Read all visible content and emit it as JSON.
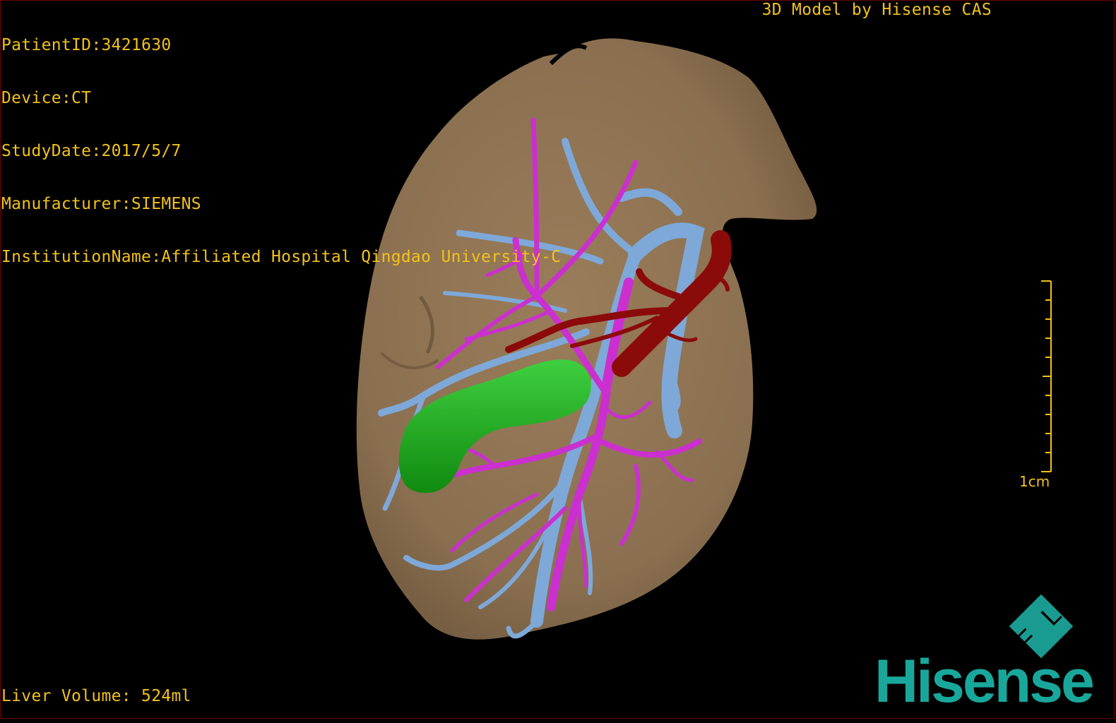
{
  "overlay": {
    "patient_id": "PatientID:3421630",
    "device": "Device:CT",
    "study_date": "StudyDate:2017/5/7",
    "manufacturer": "Manufacturer:SIEMENS",
    "institution": "InstitutionName:Affiliated Hospital Qingdao University-C",
    "model_credit": "3D Model by Hisense CAS",
    "liver_volume": "Liver Volume: 524ml",
    "scale_label": "1cm"
  },
  "logo": {
    "word": "Hisense",
    "mark": "F L"
  },
  "colors": {
    "background": "#000000",
    "text": "#f2c21a",
    "liver": "#8c7252",
    "portal_vein": "#7ea8d8",
    "bile_duct": "#cc2fd0",
    "hepatic_artery": "#8b0a0a",
    "gallbladder": "#1e9e1e",
    "logo": "#1aa79b"
  }
}
